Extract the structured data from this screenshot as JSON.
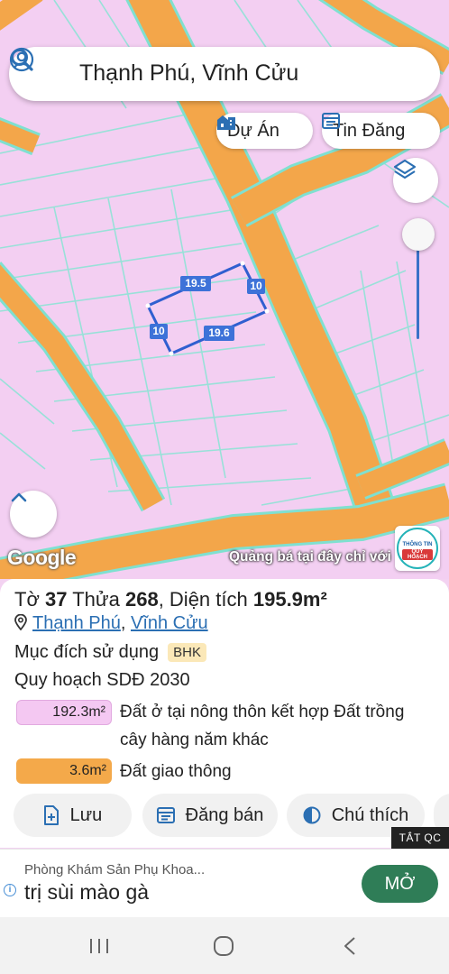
{
  "status_bar": {},
  "search": {
    "query": "Thạnh Phú, Vĩnh Cửu"
  },
  "map_chips": {
    "du_an": "Dự Án",
    "tin_dang": "Tin Đăng"
  },
  "map": {
    "edge_labels": {
      "top": "19.5",
      "right": "10",
      "left": "10",
      "bottom": "19.6"
    },
    "google": "Google",
    "ad_overlay": "Quảng bá tại đây chỉ với",
    "badge": {
      "line1": "THÔNG TIN",
      "line2": "QUY HOẠCH"
    },
    "colors": {
      "residential": "#f3cff2",
      "road": "#f3a64a",
      "road_border": "#7fe0d0",
      "parcel_outline": "#2f5fd0"
    }
  },
  "parcel": {
    "to_label": "Tờ",
    "to_value": "37",
    "thua_label": "Thửa",
    "thua_value": "268",
    "area_label": ", Diện tích",
    "area_value": "195.9m²",
    "ward": "Thạnh Phú",
    "district": "Vĩnh Cửu",
    "location_sep": ", ",
    "purpose_label": "Mục đích sử dụng",
    "purpose_code": "BHK",
    "plan_title": "Quy hoạch SDĐ 2030",
    "zones": [
      {
        "area": "192.3m²",
        "desc": "Đất ở tại nông thôn kết hợp Đất trồng cây hàng năm khác",
        "color": "#f4c8f2"
      },
      {
        "area": "3.6m²",
        "desc": "Đất giao thông",
        "color": "#f4a94a"
      }
    ]
  },
  "actions": {
    "save": "Lưu",
    "sell": "Đăng bán",
    "legend": "Chú thích"
  },
  "close_ads": "TẮT QC",
  "ad": {
    "advertiser": "Phòng Khám Sản Phụ Khoa...",
    "headline": "trị sùi mào gà",
    "cta": "MỞ"
  }
}
